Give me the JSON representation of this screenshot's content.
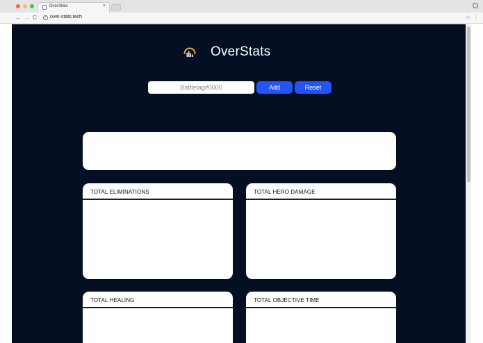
{
  "browser": {
    "tab_title": "OverStats",
    "tab_close": "×",
    "url": "over-stats.tech"
  },
  "app": {
    "brand": "OverStats",
    "search": {
      "placeholder": "Battletag#0000",
      "value": ""
    },
    "add_label": "Add",
    "reset_label": "Reset",
    "accent_color": "#2355f5",
    "background_color": "#040f23"
  },
  "cards": {
    "eliminations": "TOTAL ELIMINATIONS",
    "hero_damage": "TOTAL HERO DAMAGE",
    "healing": "TOTAL HEALING",
    "objective_time": "TOTAL OBJECTIVE TIME"
  },
  "icons": {
    "logo": "overstats-logo-icon",
    "back": "arrow-left-icon",
    "forward": "arrow-right-icon",
    "reload": "reload-icon",
    "info": "info-icon",
    "bookmark": "star-icon",
    "menu": "kebab-menu-icon",
    "profile": "profile-icon"
  }
}
